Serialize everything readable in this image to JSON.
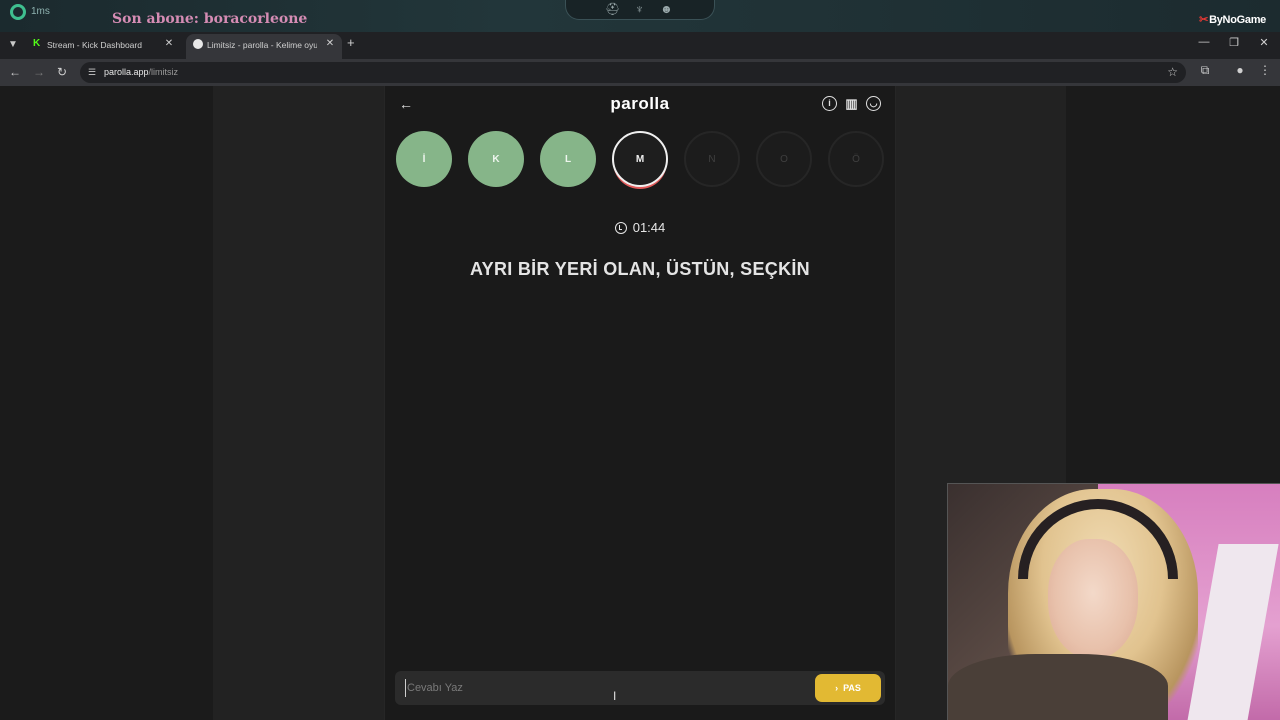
{
  "overlay": {
    "ping": "1ms",
    "subscriber": "Son abone: boracorleone",
    "brand": "ByNoGame"
  },
  "browser": {
    "tabs": [
      {
        "title": "Stream - Kick Dashboard",
        "favicon": "kick-logo",
        "active": false
      },
      {
        "title": "Limitsiz - parolla - Kelime oyunu",
        "favicon": "parolla-logo",
        "active": true
      }
    ],
    "url_host": "parolla.app",
    "url_path": "/limitsiz"
  },
  "app": {
    "title": "parolla",
    "letters": [
      {
        "label": "İ",
        "state": "done"
      },
      {
        "label": "K",
        "state": "done"
      },
      {
        "label": "L",
        "state": "done"
      },
      {
        "label": "M",
        "state": "active"
      },
      {
        "label": "N",
        "state": "pending"
      },
      {
        "label": "O",
        "state": "pending"
      },
      {
        "label": "Ö",
        "state": "pending"
      }
    ],
    "timer": "01:44",
    "clue": "AYRI BİR YERİ OLAN, ÜSTÜN, SEÇKİN",
    "answer_placeholder": "Cevabı Yaz",
    "pass_label": "PAS"
  },
  "colors": {
    "done": "#86b589",
    "active_ring": "#e05a5a",
    "pass_button": "#e2b933"
  }
}
